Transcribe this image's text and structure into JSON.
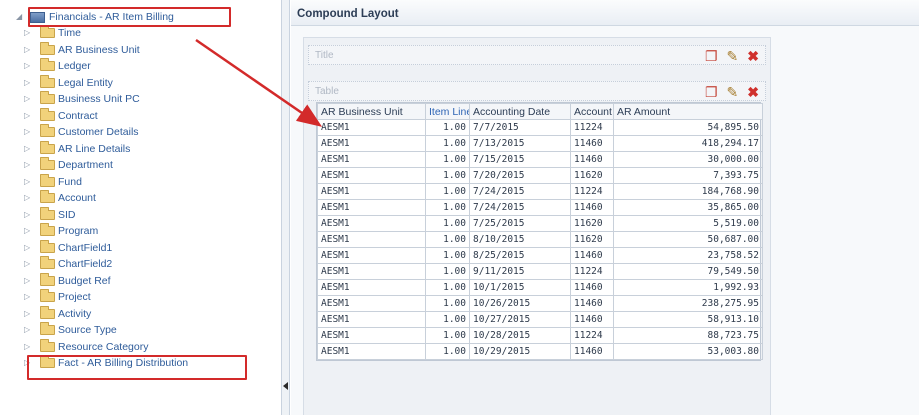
{
  "tree": {
    "root_label": "Financials - AR Item Billing",
    "items": [
      {
        "label": "Time"
      },
      {
        "label": "AR Business Unit"
      },
      {
        "label": "Ledger"
      },
      {
        "label": "Legal Entity"
      },
      {
        "label": "Business Unit PC"
      },
      {
        "label": "Contract"
      },
      {
        "label": "Customer Details"
      },
      {
        "label": "AR Line Details"
      },
      {
        "label": "Department"
      },
      {
        "label": "Fund"
      },
      {
        "label": "Account"
      },
      {
        "label": "SID"
      },
      {
        "label": "Program"
      },
      {
        "label": "ChartField1"
      },
      {
        "label": "ChartField2"
      },
      {
        "label": "Budget Ref"
      },
      {
        "label": "Project"
      },
      {
        "label": "Activity"
      },
      {
        "label": "Source Type"
      },
      {
        "label": "Resource Category"
      },
      {
        "label": "Fact - AR Billing Distribution"
      }
    ]
  },
  "layout": {
    "title": "Compound Layout",
    "views": [
      {
        "name": "Title"
      },
      {
        "name": "Table"
      }
    ]
  },
  "table": {
    "columns": [
      "AR Business Unit",
      "Item Line",
      "Accounting Date",
      "Account",
      "AR Amount"
    ],
    "rows": [
      [
        "AESM1",
        "1.00",
        "7/7/2015",
        "11224",
        "54,895.50"
      ],
      [
        "AESM1",
        "1.00",
        "7/13/2015",
        "11460",
        "418,294.17"
      ],
      [
        "AESM1",
        "1.00",
        "7/15/2015",
        "11460",
        "30,000.00"
      ],
      [
        "AESM1",
        "1.00",
        "7/20/2015",
        "11620",
        "7,393.75"
      ],
      [
        "AESM1",
        "1.00",
        "7/24/2015",
        "11224",
        "184,768.90"
      ],
      [
        "AESM1",
        "1.00",
        "7/24/2015",
        "11460",
        "35,865.00"
      ],
      [
        "AESM1",
        "1.00",
        "7/25/2015",
        "11620",
        "5,519.00"
      ],
      [
        "AESM1",
        "1.00",
        "8/10/2015",
        "11620",
        "50,687.00"
      ],
      [
        "AESM1",
        "1.00",
        "8/25/2015",
        "11460",
        "23,758.52"
      ],
      [
        "AESM1",
        "1.00",
        "9/11/2015",
        "11224",
        "79,549.50"
      ],
      [
        "AESM1",
        "1.00",
        "10/1/2015",
        "11460",
        "1,992.93"
      ],
      [
        "AESM1",
        "1.00",
        "10/26/2015",
        "11460",
        "238,275.95"
      ],
      [
        "AESM1",
        "1.00",
        "10/27/2015",
        "11460",
        "58,913.10"
      ],
      [
        "AESM1",
        "1.00",
        "10/28/2015",
        "11224",
        "88,723.75"
      ],
      [
        "AESM1",
        "1.00",
        "10/29/2015",
        "11460",
        "53,003.80"
      ]
    ]
  },
  "icons": {
    "expander": "expand-triangle-icon",
    "folder": "folder-icon",
    "subject_area": "subject-area-icon",
    "format_view": "format-view-icon",
    "edit_view": "edit-pencil-icon",
    "remove_view": "remove-x-icon"
  },
  "colors": {
    "highlight": "#d32a2a",
    "link": "#2f65b5"
  }
}
